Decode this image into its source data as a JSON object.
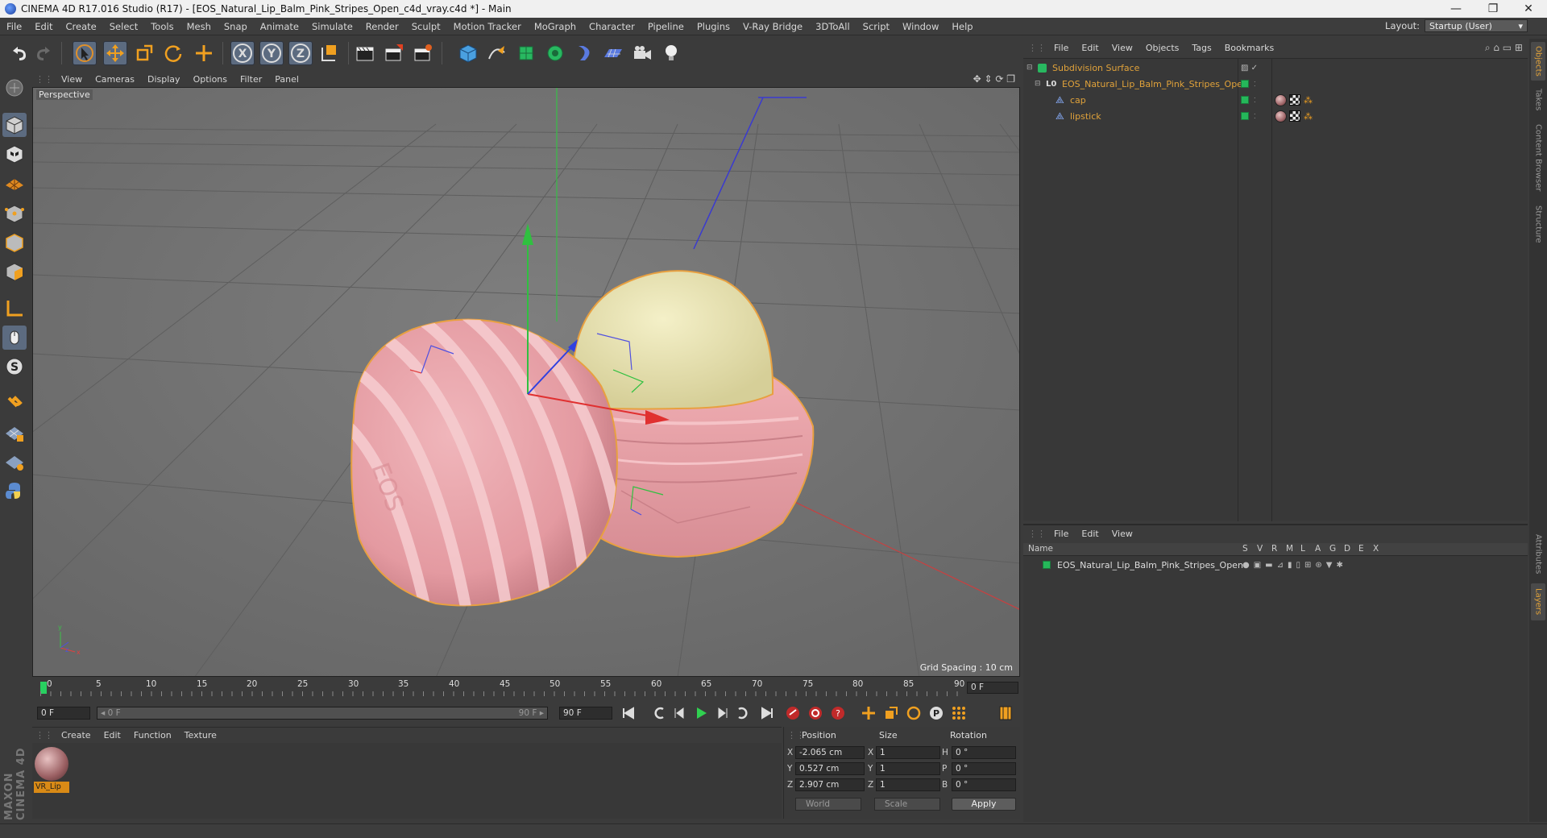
{
  "window": {
    "title": "CINEMA 4D R17.016 Studio (R17) - [EOS_Natural_Lip_Balm_Pink_Stripes_Open_c4d_vray.c4d *] - Main",
    "controls": {
      "minimize": "—",
      "restore": "❐",
      "close": "✕"
    }
  },
  "menubar": {
    "items": [
      "File",
      "Edit",
      "Create",
      "Select",
      "Tools",
      "Mesh",
      "Snap",
      "Animate",
      "Simulate",
      "Render",
      "Sculpt",
      "Motion Tracker",
      "MoGraph",
      "Character",
      "Pipeline",
      "Plugins",
      "V-Ray Bridge",
      "3DToAll",
      "Script",
      "Window",
      "Help"
    ],
    "layout_label": "Layout:",
    "layout_value": "Startup (User)"
  },
  "toolbar": {
    "icons": [
      "undo-icon",
      "redo-icon",
      "live-select-icon",
      "move-icon",
      "scale-icon",
      "rotate-icon",
      "last-tool-icon",
      "x-axis-icon",
      "y-axis-icon",
      "z-axis-icon",
      "coordinate-system-icon",
      "render-view-icon",
      "render-picture-viewer-icon",
      "edit-render-settings-icon",
      "cube-icon",
      "pen-spline-icon",
      "subdivision-icon",
      "cloner-icon",
      "deformer-icon",
      "floor-icon",
      "camera-icon",
      "light-icon"
    ],
    "axis_labels": {
      "x": "X",
      "y": "Y",
      "z": "Z"
    }
  },
  "viewport": {
    "menu": [
      "View",
      "Cameras",
      "Display",
      "Options",
      "Filter",
      "Panel"
    ],
    "label": "Perspective",
    "grid_spacing": "Grid Spacing : 10 cm",
    "colors": {
      "background": "#737373",
      "cap_pink": "#e9a6ac",
      "balm_cream": "#ebe6b6",
      "selection_outline": "#e8a040"
    }
  },
  "timeline": {
    "ticks": [
      "0",
      "5",
      "10",
      "15",
      "20",
      "25",
      "30",
      "35",
      "40",
      "45",
      "50",
      "55",
      "60",
      "65",
      "70",
      "75",
      "80",
      "85",
      "90"
    ],
    "current_frame": "0 F",
    "start_field": "0 F",
    "range_start": "◂ 0 F",
    "range_end": "90 F ▸",
    "end_field": "90 F"
  },
  "material_manager": {
    "menu": [
      "Create",
      "Edit",
      "Function",
      "Texture"
    ],
    "materials": [
      {
        "name": "VR_Lip"
      }
    ]
  },
  "coordinates": {
    "headers": {
      "position": "Position",
      "size": "Size",
      "rotation": "Rotation"
    },
    "rows": [
      {
        "axis": "X",
        "pos": "-2.065 cm",
        "size_axis": "X",
        "size": "1",
        "rot_axis": "H",
        "rot": "0 °"
      },
      {
        "axis": "Y",
        "pos": "0.527 cm",
        "size_axis": "Y",
        "size": "1",
        "rot_axis": "P",
        "rot": "0 °"
      },
      {
        "axis": "Z",
        "pos": "2.907 cm",
        "size_axis": "Z",
        "size": "1",
        "rot_axis": "B",
        "rot": "0 °"
      }
    ],
    "mode": "World",
    "size_mode": "Scale",
    "apply": "Apply"
  },
  "object_manager": {
    "menu": [
      "File",
      "Edit",
      "View",
      "Objects",
      "Tags",
      "Bookmarks"
    ],
    "objects": [
      {
        "name": "Subdivision Surface"
      },
      {
        "name": "EOS_Natural_Lip_Balm_Pink_Stripes_Open"
      },
      {
        "name": "cap"
      },
      {
        "name": "lipstick"
      }
    ]
  },
  "layer_manager": {
    "menu": [
      "File",
      "Edit",
      "View"
    ],
    "columns": [
      "Name",
      "S",
      "V",
      "R",
      "M",
      "L",
      "A",
      "G",
      "D",
      "E",
      "X"
    ],
    "layers": [
      {
        "name": "EOS_Natural_Lip_Balm_Pink_Stripes_Open"
      }
    ]
  },
  "right_tabs": [
    "Objects",
    "Takes",
    "Content Browser",
    "Structure",
    "Attributes",
    "Layers"
  ],
  "branding": "MAXON CINEMA 4D"
}
